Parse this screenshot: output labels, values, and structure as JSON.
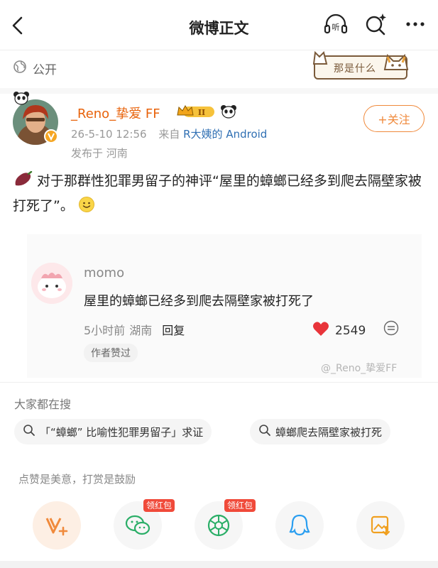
{
  "header": {
    "title": "微博正文",
    "listen_label": "听"
  },
  "visibility": {
    "label": "公开"
  },
  "sticker": {
    "text": "那是什么"
  },
  "post": {
    "username": "_Reno_挚爱 FF",
    "level_badge": "II",
    "timestamp": "26-5-10 12:56",
    "source_prefix": "来自",
    "source": "R大姨的 Android",
    "location": "发布于 河南",
    "follow_label": "+关注",
    "text": "对于那群性犯罪男留子的神评“屋里的蟑螂已经多到爬去隔壁家被打死了”。"
  },
  "quoted_comment": {
    "name": "momo",
    "text": "屋里的蟑螂已经多到爬去隔壁家被打死了",
    "time": "5小时前",
    "location": "湖南",
    "reply_label": "回复",
    "likes": "2549",
    "author_tag": "作者赞过",
    "watermark": "@_Reno_挚爱FF"
  },
  "trending": {
    "label": "大家都在搜",
    "chips": [
      "「“蟑螂” 比喻性犯罪男留子」求证",
      "蟑螂爬去隔壁家被打死"
    ]
  },
  "reward": {
    "label": "点赞是美意，打赏是鼓励",
    "hongbao_label": "领红包"
  },
  "colors": {
    "accent": "#f08a3c",
    "username": "#e8620a",
    "link": "#2f6fb3",
    "like": "#e8343a"
  }
}
